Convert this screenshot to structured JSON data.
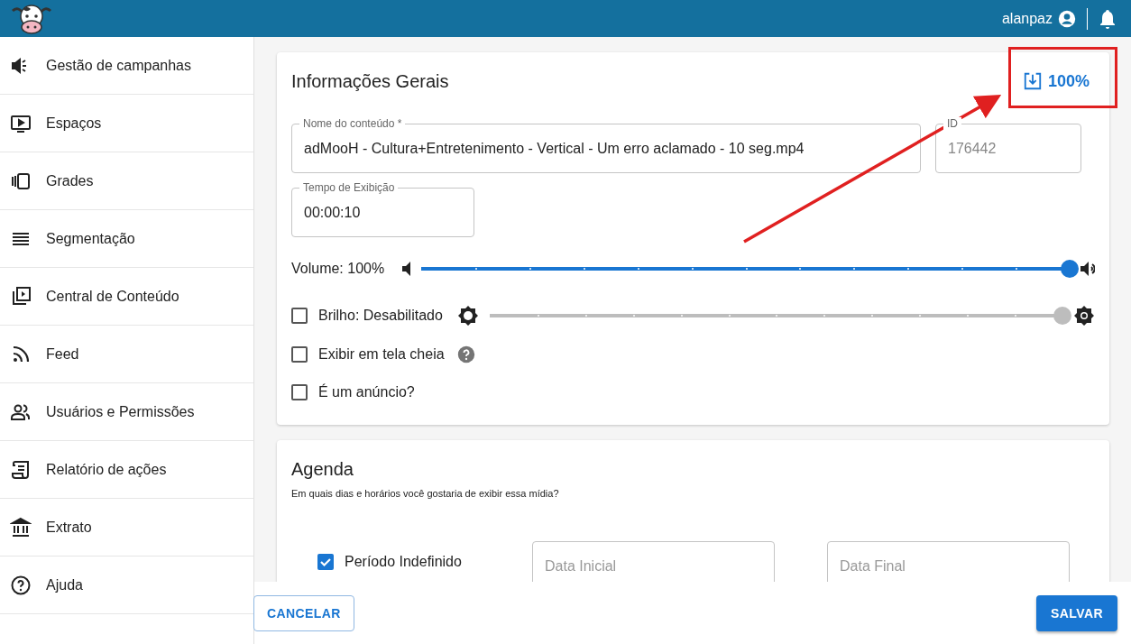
{
  "header": {
    "user": "alanpaz"
  },
  "sidebar": {
    "items": [
      {
        "label": "Gestão de campanhas",
        "kind": "megaphone"
      },
      {
        "label": "Espaços",
        "kind": "tv"
      },
      {
        "label": "Grades",
        "kind": "carousel"
      },
      {
        "label": "Segmentação",
        "kind": "lines"
      },
      {
        "label": "Central de Conteúdo",
        "kind": "library"
      },
      {
        "label": "Feed",
        "kind": "rss"
      },
      {
        "label": "Usuários e Permissões",
        "kind": "people"
      },
      {
        "label": "Relatório de ações",
        "kind": "scroll"
      },
      {
        "label": "Extrato",
        "kind": "bank"
      },
      {
        "label": "Ajuda",
        "kind": "help"
      }
    ]
  },
  "general_info": {
    "title": "Informações Gerais",
    "download": {
      "label": "100%"
    },
    "fields": [
      {
        "label": "Nome do conteúdo *",
        "value": "adMooH - Cultura+Entretenimento - Vertical - Um erro aclamado - 10 seg.mp4",
        "disabled": false
      },
      {
        "label": "ID",
        "value": "176442",
        "disabled": true
      },
      {
        "label": "Tempo de Exibição",
        "value": "00:00:10",
        "disabled": false
      }
    ],
    "volume": {
      "label": "Volume: 100%",
      "level": 1,
      "disabled": false
    },
    "brightness": {
      "label": "Brilho: Desabilitado",
      "checked": false,
      "level": 1,
      "disabled": true
    },
    "options": [
      {
        "label": "Exibir em tela cheia",
        "checked": false,
        "help": true
      },
      {
        "label": "É um anúncio?",
        "checked": false,
        "help": false
      }
    ]
  },
  "agenda": {
    "title": "Agenda",
    "subtitle": "Em quais dias e horários você gostaria de exibir essa mídia?",
    "indefinite": {
      "label": "Período Indefinido",
      "checked": true
    },
    "fields": [
      {
        "placeholder": "Data Inicial"
      },
      {
        "placeholder": "Data Final"
      }
    ]
  },
  "footer": {
    "buttons": [
      {
        "label": "CANCELAR",
        "kind": "outlined"
      },
      {
        "label": "SALVAR",
        "kind": "contained"
      }
    ]
  }
}
